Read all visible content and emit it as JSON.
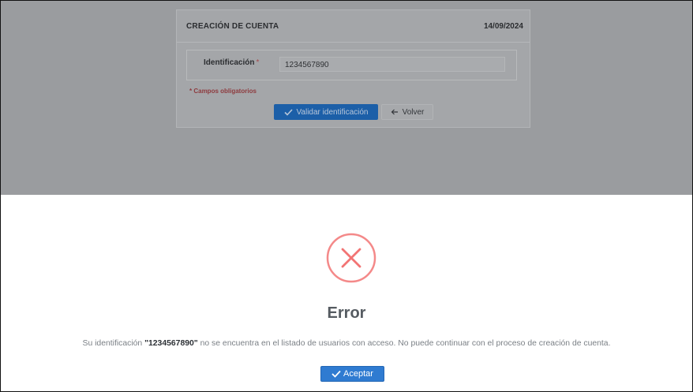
{
  "form": {
    "title": "CREACIÓN DE CUENTA",
    "date": "14/09/2024",
    "id_label": "Identificación",
    "required_mark": "*",
    "id_value": "1234567890",
    "required_note": "* Campos obligatorios",
    "validate_label": "Validar identificación",
    "back_label": "Volver"
  },
  "modal": {
    "title": "Error",
    "message_prefix": "Su identificación ",
    "message_id": "\"1234567890\"",
    "message_suffix": " no se encuentra en el listado de usuarios con acceso. No puede continuar con el proceso de creación de cuenta.",
    "accept_label": "Aceptar"
  },
  "icons": {
    "error": "x-circle-icon",
    "check": "check-icon",
    "back": "arrow-left-icon"
  },
  "colors": {
    "error_red": "#f27474",
    "primary_blue": "#2f7bd1"
  }
}
